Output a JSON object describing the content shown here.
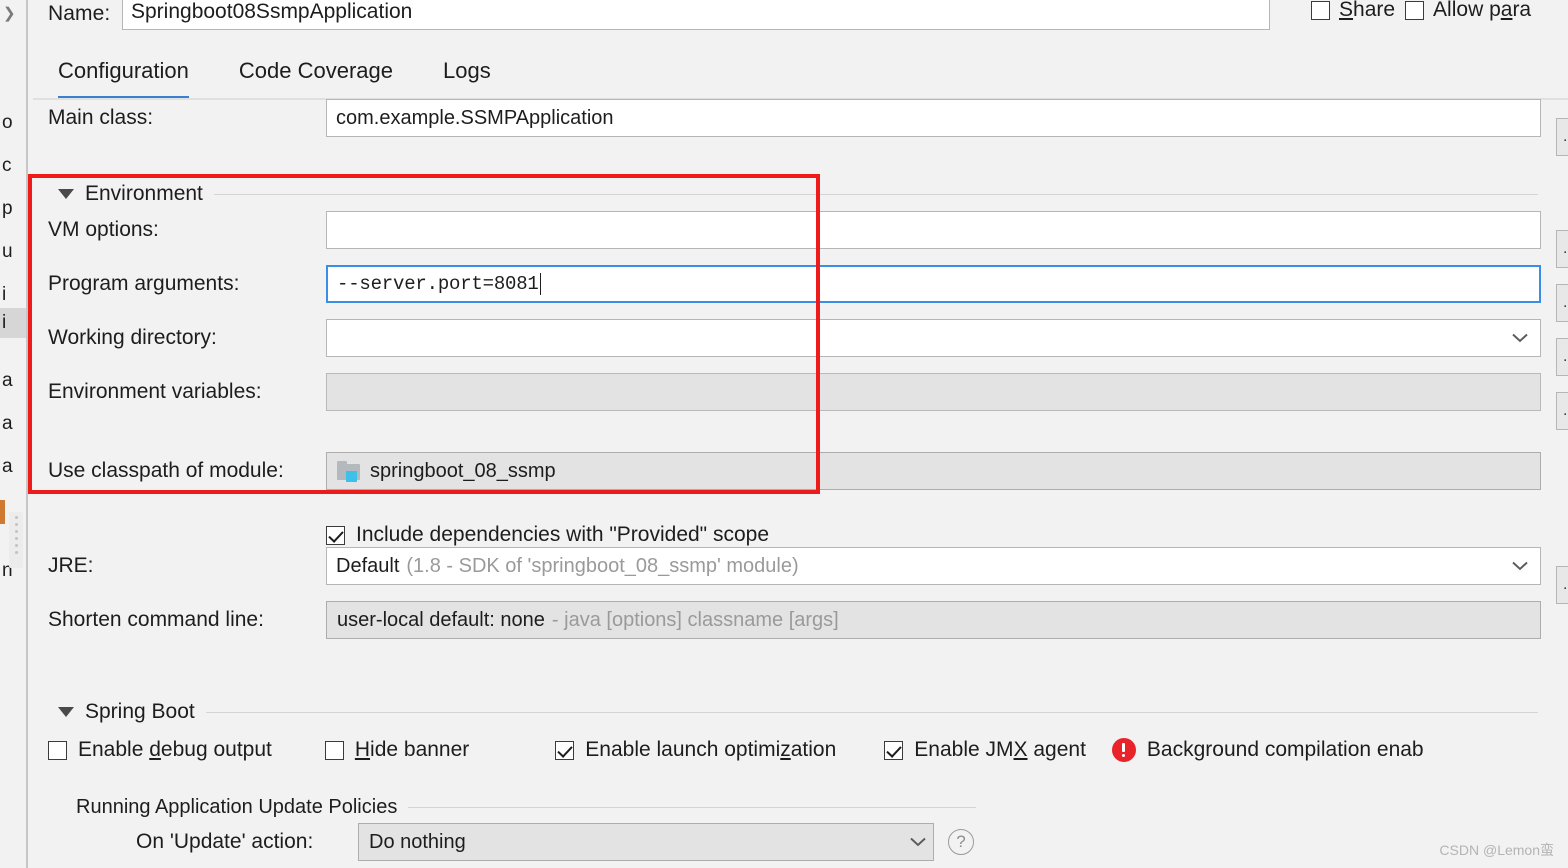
{
  "window": {
    "name_label": "Name:",
    "name_value": "Springboot08SsmpApplication",
    "share_label": "Share",
    "share_mnemonic": "S",
    "allow_parallel_label": "Allow para",
    "allow_parallel_mnemonic": "a"
  },
  "tabs": [
    {
      "label": "Configuration",
      "active": true
    },
    {
      "label": "Code Coverage",
      "active": false
    },
    {
      "label": "Logs",
      "active": false
    }
  ],
  "form": {
    "main_class": {
      "label": "Main class:",
      "value": "com.example.SSMPApplication"
    },
    "environment_group": {
      "title": "Environment"
    },
    "vm_options": {
      "label": "VM options:",
      "value": ""
    },
    "program_arguments": {
      "label": "Program arguments:",
      "value": "--server.port=8081"
    },
    "working_directory": {
      "label": "Working directory:",
      "value": ""
    },
    "environment_variables": {
      "label": "Environment variables:",
      "value": ""
    },
    "use_classpath": {
      "label": "Use classpath of module:",
      "value": "springboot_08_ssmp",
      "icon": "module-folder-icon"
    },
    "include_provided": {
      "label": "Include dependencies with \"Provided\" scope",
      "checked": true
    },
    "jre": {
      "label": "JRE:",
      "value_strong": "Default",
      "value_muted": "(1.8 - SDK of 'springboot_08_ssmp' module)"
    },
    "shorten_command_line": {
      "label": "Shorten command line:",
      "value_strong": "user-local default: none",
      "value_muted": "- java [options] classname [args]"
    }
  },
  "spring_boot": {
    "group_title": "Spring Boot",
    "checkboxes": [
      {
        "label": "Enable debug output",
        "mnemonic": "d",
        "checked": false
      },
      {
        "label": "Hide banner",
        "mnemonic": "H",
        "checked": false
      },
      {
        "label": "Enable launch optimization",
        "mnemonic": "z",
        "checked": true
      },
      {
        "label": "Enable JMX agent",
        "mnemonic": "X",
        "checked": true
      }
    ],
    "background_warning": {
      "icon": "error-icon",
      "text": "Background compilation enab"
    },
    "update_policies": {
      "group_title": "Running Application Update Policies",
      "on_update_label": "On 'Update' action:",
      "on_update_value": "Do nothing",
      "help_icon": "help-icon"
    }
  },
  "left_strip": {
    "chevron_icon": "chevron-right-icon",
    "fragments": [
      "o",
      "c",
      "p",
      "u",
      "i",
      "i",
      "a",
      "a",
      "a",
      "n"
    ]
  },
  "watermark": "CSDN @Lemon蛮",
  "colors": {
    "accent_blue": "#3a7fd0",
    "focus_blue": "#3a8ee6",
    "annotation_red": "#ee1b1b",
    "error_red": "#e8242a",
    "module_chip": "#3fc0e8"
  }
}
